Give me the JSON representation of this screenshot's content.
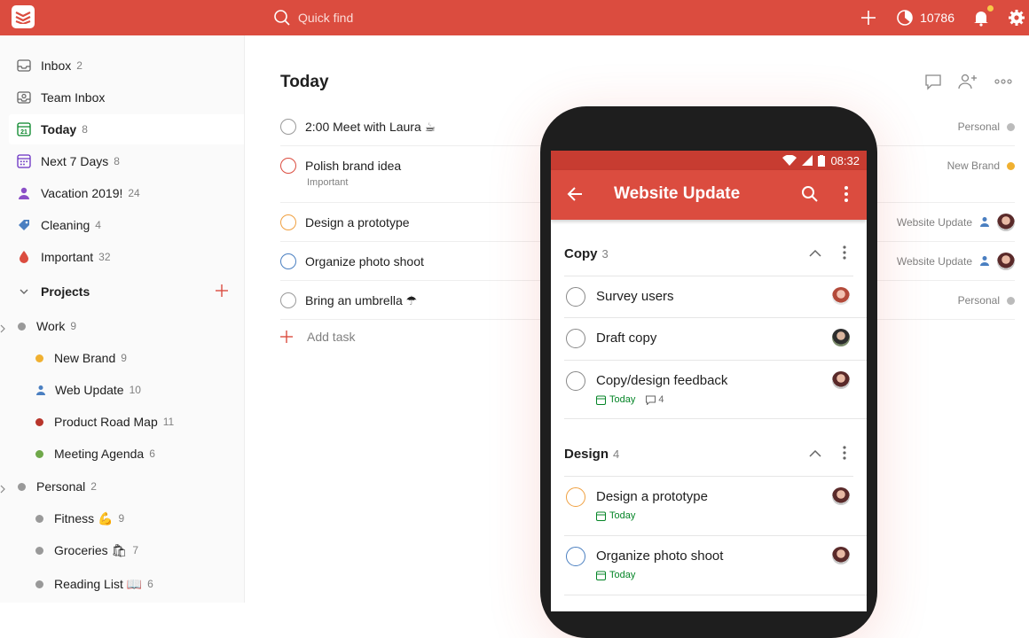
{
  "topbar": {
    "search_placeholder": "Quick find",
    "karma": "10786"
  },
  "sidebar": {
    "items": [
      {
        "label": "Inbox",
        "count": "2"
      },
      {
        "label": "Team Inbox",
        "count": ""
      },
      {
        "label": "Today",
        "count": "8"
      },
      {
        "label": "Next 7 Days",
        "count": "8"
      },
      {
        "label": "Vacation 2019!",
        "count": "24"
      },
      {
        "label": "Cleaning",
        "count": "4"
      },
      {
        "label": "Important",
        "count": "32"
      }
    ],
    "projects_label": "Projects",
    "projects": [
      {
        "label": "Work",
        "count": "9",
        "color": "#999999"
      },
      {
        "label": "New Brand",
        "count": "9",
        "color": "#f0b030"
      },
      {
        "label": "Web Update",
        "count": "10",
        "color": "#4a7fc1"
      },
      {
        "label": "Product Road Map",
        "count": "11",
        "color": "#b8352b"
      },
      {
        "label": "Meeting Agenda",
        "count": "6",
        "color": "#6fa84a"
      },
      {
        "label": "Personal",
        "count": "2",
        "color": "#999999"
      },
      {
        "label": "Fitness 💪",
        "count": "9",
        "color": "#999999"
      },
      {
        "label": "Groceries 🛍",
        "count": "7",
        "color": "#999999"
      },
      {
        "label": "Reading List 📖",
        "count": "6",
        "color": "#999999"
      }
    ]
  },
  "main": {
    "title": "Today",
    "tasks": [
      {
        "title": "2:00 Meet with Laura ☕",
        "sub": "",
        "project": "Personal",
        "circle": "#999999",
        "dot": "#bbbbbb"
      },
      {
        "title": "Polish brand idea",
        "sub": "Important",
        "project": "New Brand",
        "circle": "#db4c3f",
        "dot": "#f0b030"
      },
      {
        "title": "Design a prototype",
        "sub": "",
        "project": "Website Update",
        "circle": "#f0a040",
        "dot": ""
      },
      {
        "title": "Organize photo shoot",
        "sub": "",
        "project": "Website Update",
        "circle": "#4a7fc1",
        "dot": ""
      },
      {
        "title": "Bring an umbrella ☂",
        "sub": "",
        "project": "Personal",
        "circle": "#999999",
        "dot": "#bbbbbb"
      }
    ],
    "add_task": "Add task"
  },
  "phone": {
    "time": "08:32",
    "title": "Website Update",
    "sections": [
      {
        "name": "Copy",
        "count": "3"
      },
      {
        "name": "Design",
        "count": "4"
      }
    ],
    "tasks": [
      {
        "title": "Survey users",
        "date": "",
        "comments": ""
      },
      {
        "title": "Draft copy",
        "date": "",
        "comments": ""
      },
      {
        "title": "Copy/design feedback",
        "date": "Today",
        "comments": "4"
      },
      {
        "title": "Design a prototype",
        "date": "Today",
        "comments": ""
      },
      {
        "title": "Organize photo shoot",
        "date": "Today",
        "comments": ""
      }
    ]
  }
}
